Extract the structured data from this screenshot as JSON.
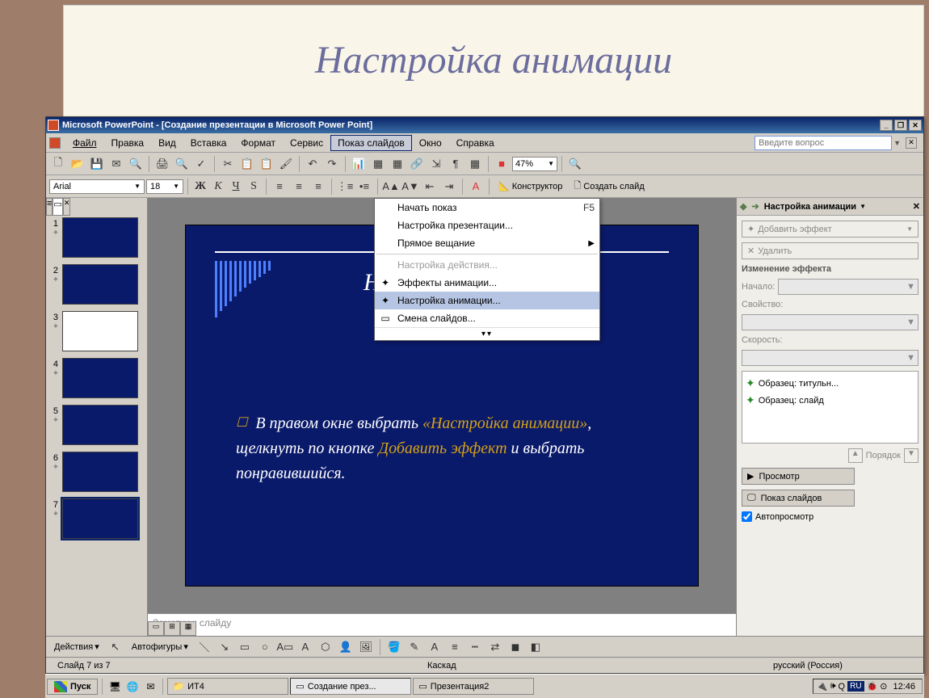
{
  "page": {
    "title": "Настройка анимации"
  },
  "window": {
    "title": "Microsoft PowerPoint - [Создание презентации в Microsoft Power Point]"
  },
  "menubar": {
    "items": [
      "Файл",
      "Правка",
      "Вид",
      "Вставка",
      "Формат",
      "Сервис",
      "Показ слайдов",
      "Окно",
      "Справка"
    ],
    "open_index": 6,
    "help_placeholder": "Введите вопрос"
  },
  "toolbar": {
    "zoom": "47%",
    "font_name": "Arial",
    "font_size": "18",
    "designer": "Конструктор",
    "new_slide": "Создать слайд"
  },
  "dropdown": {
    "items": [
      {
        "label": "Начать показ",
        "shortcut": "F5",
        "icon": ""
      },
      {
        "label": "Настройка презентации...",
        "shortcut": "",
        "icon": ""
      },
      {
        "label": "Прямое вещание",
        "shortcut": "",
        "submenu": true,
        "icon": ""
      },
      {
        "sep": true
      },
      {
        "label": "Настройка действия...",
        "shortcut": "",
        "disabled": true,
        "icon": ""
      },
      {
        "label": "Эффекты анимации...",
        "shortcut": "",
        "icon": "✦"
      },
      {
        "label": "Настройка анимации...",
        "shortcut": "",
        "hover": true,
        "icon": "✦"
      },
      {
        "label": "Смена слайдов...",
        "shortcut": "",
        "icon": "▭"
      }
    ]
  },
  "thumbnails": {
    "count": 7,
    "selected": 7,
    "numbers": [
      "1",
      "2",
      "3",
      "4",
      "5",
      "6",
      "7"
    ]
  },
  "slide": {
    "title_fragment": "Настр",
    "body_plain1": "В правом окне выбрать ",
    "body_kw1": "«Настройка анимации»",
    "body_plain2": ", щелкнуть по кнопке ",
    "body_kw2": "Добавить эффект",
    "body_plain3": " и выбрать понравившийся.",
    "notes": "Заметки к слайду"
  },
  "pane": {
    "title": "Настройка анимации",
    "add_effect": "Добавить эффект",
    "remove": "Удалить",
    "mod_header": "Изменение эффекта",
    "start_label": "Начало:",
    "property_label": "Свойство:",
    "speed_label": "Скорость:",
    "effects": [
      {
        "label": "Образец: титульн..."
      },
      {
        "label": "Образец: слайд"
      }
    ],
    "order": "Порядок",
    "preview": "Просмотр",
    "slideshow_btn": "Показ слайдов",
    "autopreview": "Автопросмотр"
  },
  "draw": {
    "actions": "Действия",
    "autoshapes": "Автофигуры"
  },
  "status": {
    "slide": "Слайд 7 из 7",
    "layout": "Каскад",
    "language": "русский (Россия)"
  },
  "taskbar": {
    "start": "Пуск",
    "tasks": [
      {
        "label": "ИТ4"
      },
      {
        "label": "Создание през..."
      },
      {
        "label": "Презентация2"
      }
    ],
    "lang": "RU",
    "time": "12:46"
  }
}
